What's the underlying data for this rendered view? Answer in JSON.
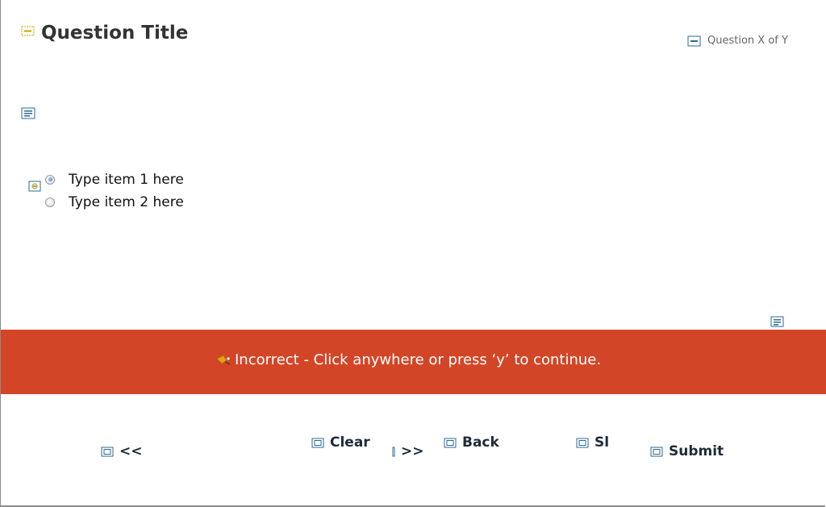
{
  "question": {
    "title": "Question Title",
    "progress": "Question X of Y"
  },
  "choices": [
    {
      "label": "Type item 1 here",
      "selected": true
    },
    {
      "label": "Type item 2 here",
      "selected": false
    }
  ],
  "feedback": {
    "text": "Incorrect - Click anywhere or press ‘y’ to continue.",
    "color": "#d24627"
  },
  "nav": {
    "prev": "<<",
    "clear": "Clear",
    "next": ">>",
    "back": "Back",
    "skip": "Sl",
    "submit": "Submit"
  },
  "colors": {
    "placeholder_icon": "#2c6a94",
    "title_placeholder_icon": "#c8a000"
  }
}
